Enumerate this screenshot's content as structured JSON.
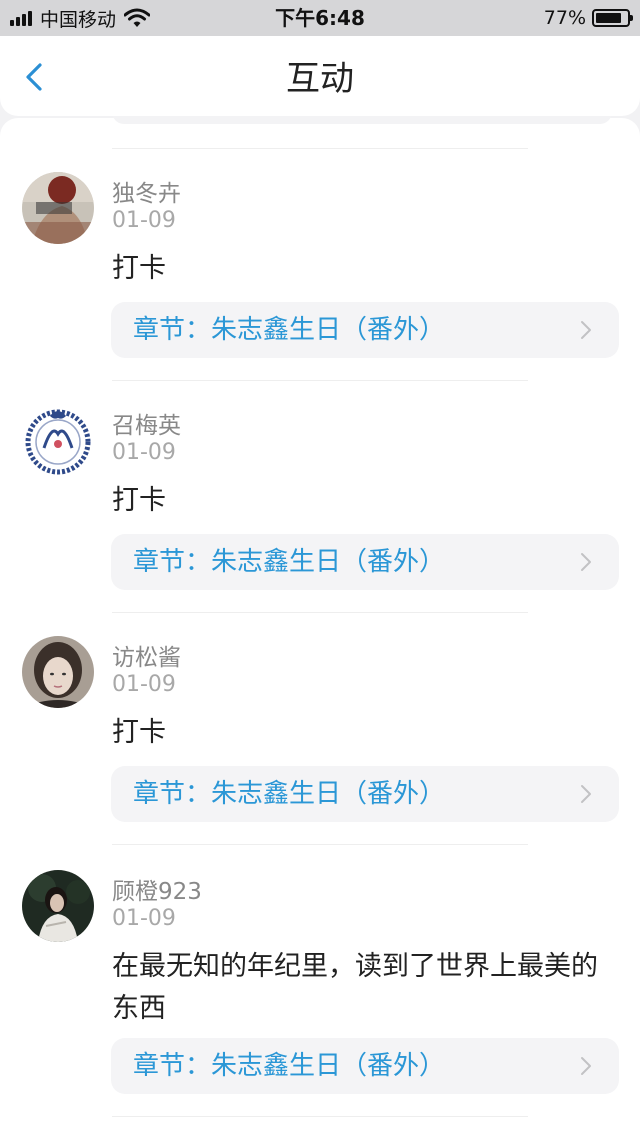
{
  "status_bar": {
    "carrier": "中国移动",
    "time": "下午6:48",
    "battery": "77%",
    "battery_level": 0.77,
    "signal_bars": 4
  },
  "nav": {
    "title": "互动",
    "back_icon": "chevron-left-icon"
  },
  "colors": {
    "accent": "#2b97d6",
    "back_arrow": "#2b8fd4",
    "name_gray": "#888888"
  },
  "comments": [
    {
      "user": "独冬卉",
      "date": "01-09",
      "text": "打卡",
      "chapter": "章节：朱志鑫生日（番外）"
    },
    {
      "user": "召梅英",
      "date": "01-09",
      "text": "打卡",
      "chapter": "章节：朱志鑫生日（番外）"
    },
    {
      "user": "访松酱",
      "date": "01-09",
      "text": "打卡",
      "chapter": "章节：朱志鑫生日（番外）"
    },
    {
      "user": "顾橙923",
      "date": "01-09",
      "text": "在最无知的年纪里，读到了世界上最美的东西",
      "chapter": "章节：朱志鑫生日（番外）"
    }
  ]
}
